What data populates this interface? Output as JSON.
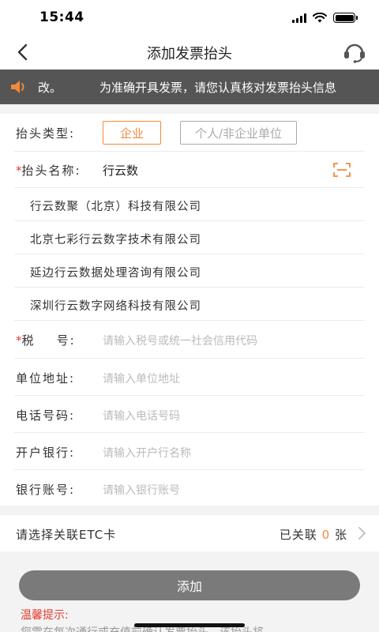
{
  "status_bar": {
    "time": "15:44"
  },
  "nav": {
    "title": "添加发票抬头"
  },
  "notice": {
    "text_tail": "改。",
    "text": "为准确开具发票，请您认真核对发票抬头信息"
  },
  "form": {
    "type": {
      "label": "抬头类型:",
      "options": [
        "企业",
        "个人/非企业单位"
      ],
      "selected": "企业"
    },
    "name": {
      "required_mark": "*",
      "label": "抬头名称:",
      "value": "行云数"
    },
    "suggestions": [
      "行云数聚（北京）科技有限公司",
      "北京七彩行云数字技术有限公司",
      "延边行云数据处理咨询有限公司",
      "深圳行云数字网络科技有限公司"
    ],
    "tax": {
      "required_mark": "*",
      "label": "税    号:",
      "placeholder": "请输入税号或统一社会信用代码"
    },
    "address": {
      "label": "单位地址:",
      "placeholder": "请输入单位地址"
    },
    "phone": {
      "label": "电话号码:",
      "placeholder": "请输入电话号码"
    },
    "bank": {
      "label": "开户银行:",
      "placeholder": "请输入开户行名称"
    },
    "account": {
      "label": "银行账号:",
      "placeholder": "请输入银行账号"
    }
  },
  "etc": {
    "label": "请选择关联ETC卡",
    "status_prefix": "已关联",
    "count": "0",
    "status_suffix": "张"
  },
  "add_button": {
    "label": "添加"
  },
  "tips": {
    "title": "温馨提示:",
    "text": "您需在每次通行或充值前确认发票抬头，该抬头将"
  },
  "colors": {
    "accent": "#f08a3c",
    "required": "#e23b2e",
    "notice_bg": "#555555",
    "button_bg": "#7a7a7a"
  },
  "icons": {
    "back": "chevron-left-icon",
    "service": "headset-icon",
    "notice": "speaker-icon",
    "scan": "scan-icon",
    "etc_arrow": "chevron-right-icon"
  }
}
